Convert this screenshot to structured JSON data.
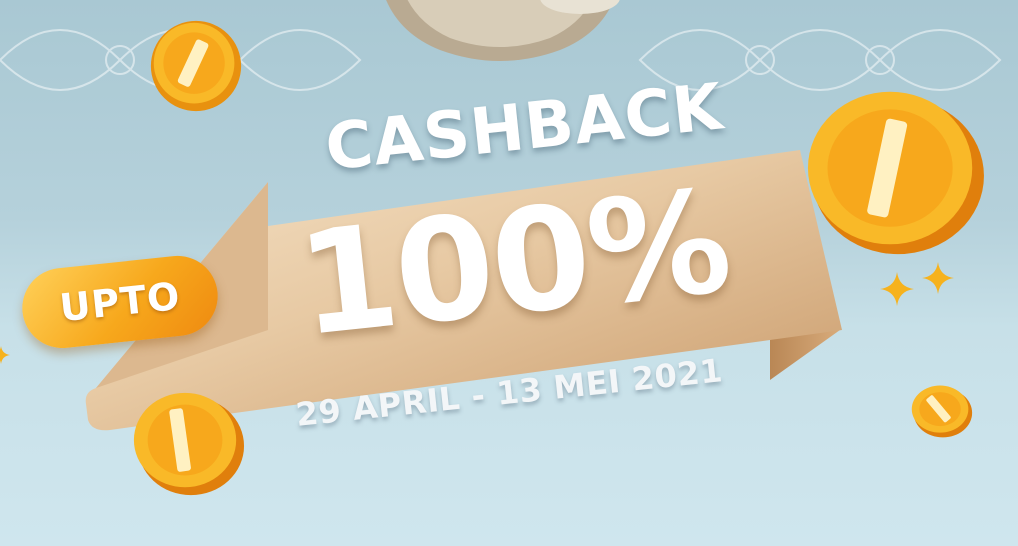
{
  "promo": {
    "headline": "CASHBACK",
    "badge": "UPTO",
    "amount": "100%",
    "period": "29 APRIL - 13 MEI 2021"
  },
  "colors": {
    "background": "#b5d1db",
    "arrow_gold": "#e7c9a3",
    "badge_orange": "#f7a81c",
    "coin_gold": "#f9b928",
    "text": "#ffffff"
  },
  "icons": [
    "coin-icon",
    "sparkle-icon",
    "money-sack-icon"
  ]
}
